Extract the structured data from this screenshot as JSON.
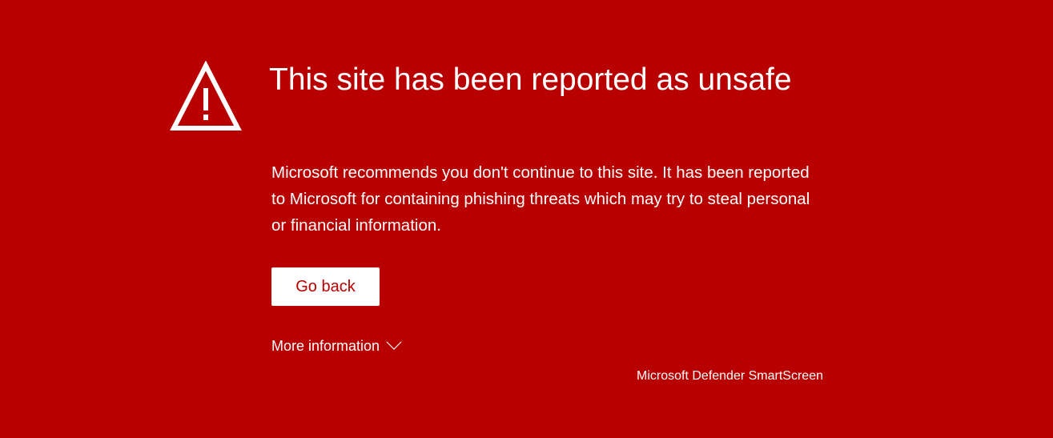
{
  "colors": {
    "background": "#b80000",
    "text": "#ffffff",
    "button_bg": "#ffffff",
    "button_text": "#b80000"
  },
  "icon": {
    "name": "warning-triangle-icon"
  },
  "title": "This site has been reported as unsafe",
  "message": "Microsoft recommends you don't continue to this site. It has been reported to Microsoft for containing phishing threats which may try to steal personal or financial information.",
  "go_back_label": "Go back",
  "more_info": {
    "label": "More information",
    "icon": "chevron-down-icon"
  },
  "footer": "Microsoft Defender SmartScreen"
}
